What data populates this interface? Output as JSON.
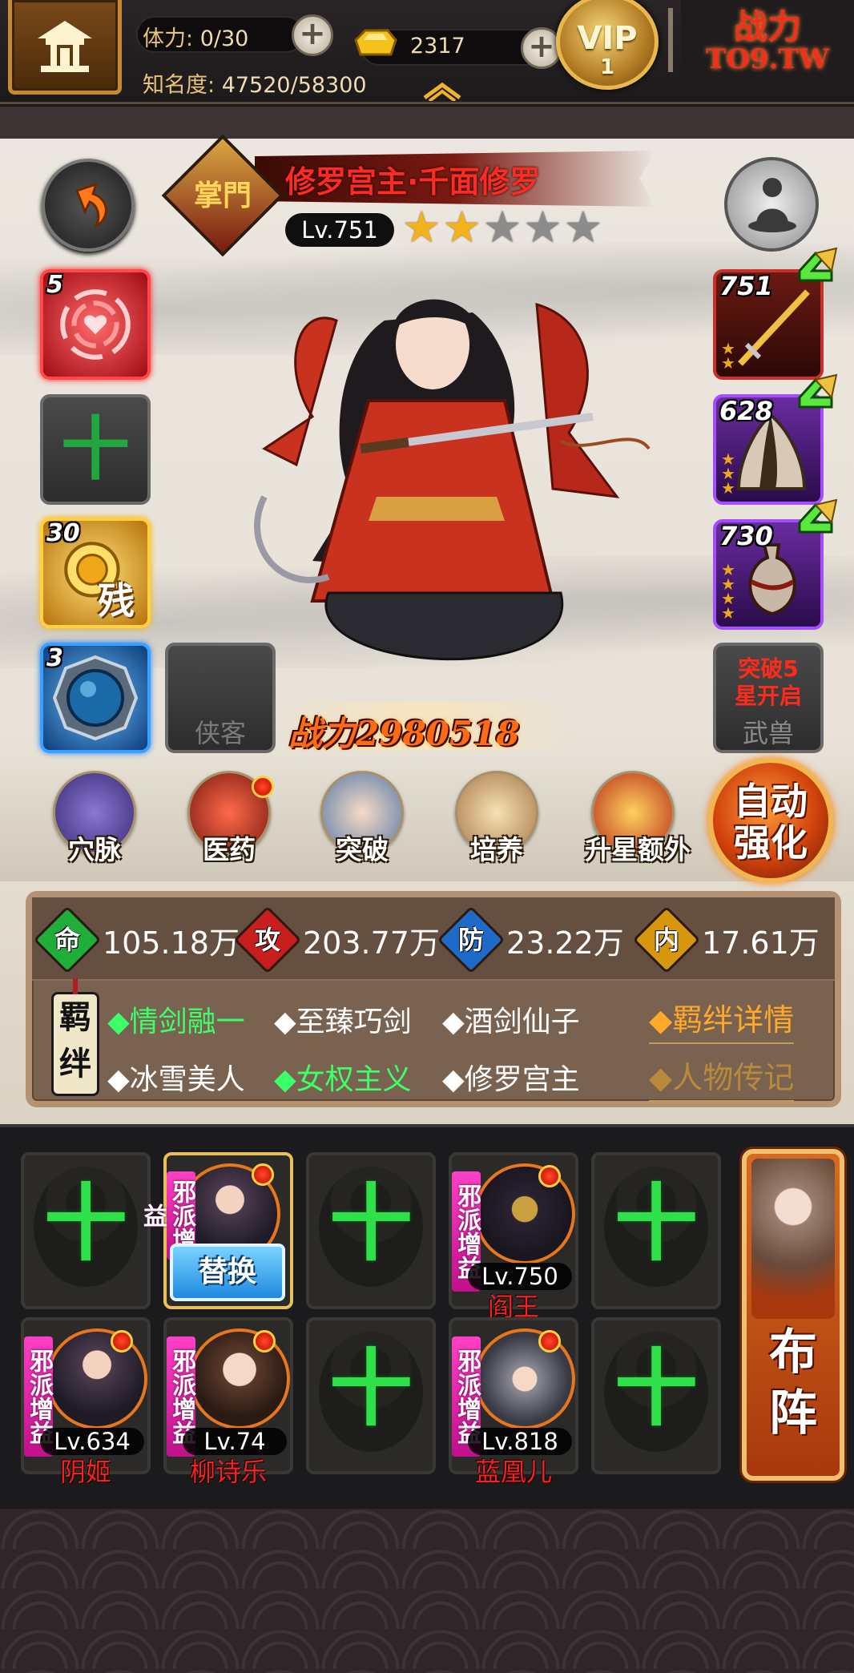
{
  "topbar": {
    "stamina_label": "体力:",
    "stamina_value": "0/30",
    "gold_value": "2317",
    "fame_label": "知名度:",
    "fame_value": "47520/58300",
    "vip_title": "VIP",
    "vip_level": "1",
    "ad_title": "战力",
    "ad_subtitle": "TO9.TW"
  },
  "hero": {
    "rank_badge": "掌門",
    "name": "修罗宫主·千面修罗",
    "level": "Lv.751",
    "stars_total": 5,
    "stars_filled": 2,
    "power_label": "战力",
    "power_value": "2980518"
  },
  "left_slots": {
    "skill_rose_level": "5",
    "skill_gold_level": "30",
    "skill_gold_glyph": "残",
    "skill_orb_level": "3",
    "companion_placeholder": "侠客"
  },
  "right_slots": {
    "weapon_level": "751",
    "armor_level": "628",
    "accessory_level": "730",
    "mount_locked_line1": "突破5",
    "mount_locked_line2": "星开启",
    "mount_label": "武兽"
  },
  "functions": [
    {
      "label": "穴脉",
      "icon": "meridian-icon",
      "dot": false
    },
    {
      "label": "医药",
      "icon": "medicine-icon",
      "dot": true
    },
    {
      "label": "突破",
      "icon": "breakthrough-icon",
      "dot": false
    },
    {
      "label": "培养",
      "icon": "cultivate-icon",
      "dot": false
    },
    {
      "label": "升星额外",
      "icon": "star-up-extra-icon",
      "dot": false
    }
  ],
  "auto_strengthen": {
    "line1": "自动",
    "line2": "强化"
  },
  "attributes": [
    {
      "label": "命",
      "value": "105.18万",
      "color": "#1fae3a"
    },
    {
      "label": "攻",
      "value": "203.77万",
      "color": "#c81e1e"
    },
    {
      "label": "防",
      "value": "23.22万",
      "color": "#1e6ac8"
    },
    {
      "label": "内",
      "value": "17.61万",
      "color": "#d8960c"
    }
  ],
  "bonds": {
    "tag": "羁绊",
    "items": [
      {
        "text": "◆情剑融一",
        "active": true
      },
      {
        "text": "◆至臻巧剑",
        "active": false
      },
      {
        "text": "◆酒剑仙子",
        "active": false
      },
      {
        "text": "◆冰雪美人",
        "active": false
      },
      {
        "text": "◆女权主义",
        "active": true
      },
      {
        "text": "◆修罗宫主",
        "active": false
      }
    ],
    "details_link": "◆羁绊详情",
    "biography_link": "◆人物传记"
  },
  "formation": {
    "sect_tag": "邪派增益",
    "swap_label": "替换",
    "button_label": "布阵",
    "members": [
      {
        "name": "阎王",
        "level": "Lv.750"
      },
      {
        "name": "阴姬",
        "level": "Lv.634"
      },
      {
        "name": "柳诗乐",
        "level": "Lv.74"
      },
      {
        "name": "蓝凰儿",
        "level": "Lv.818"
      }
    ]
  },
  "colors": {
    "bond_active": "#3cff6a",
    "bond_link": "#ffa92a",
    "hero_name": "#ff2a20",
    "member_name": "#ff1e1e",
    "add_cross": "#2ee04a"
  }
}
